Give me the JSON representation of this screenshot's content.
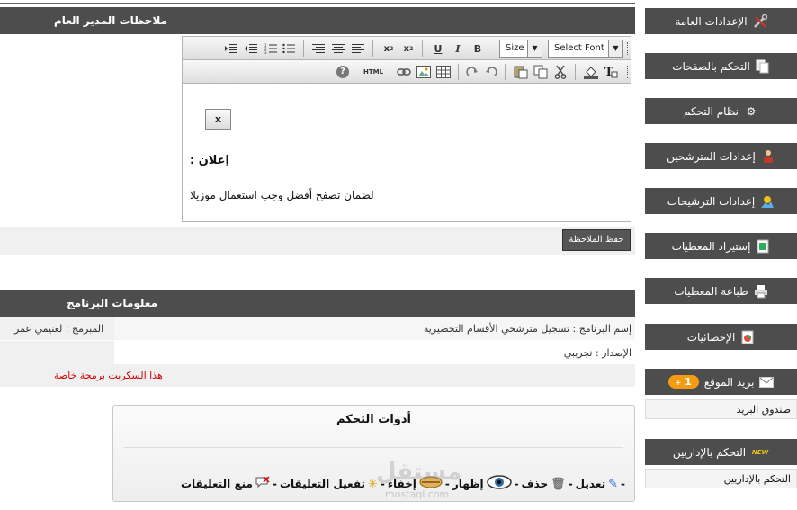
{
  "notes": {
    "header": "ملاحظات المدير العام",
    "editor": {
      "size_select": "Size",
      "font_select": "Select Font",
      "toolbar1_icons": [
        "indent-icon",
        "outdent-icon",
        "ordered-list-icon",
        "unordered-list-icon",
        "align-right-icon",
        "align-center-icon",
        "align-left-icon",
        "superscript-icon",
        "subscript-icon",
        "underline-icon",
        "italic-icon",
        "bold-icon"
      ],
      "toolbar2_icons": [
        "help-icon",
        "html-icon",
        "link-icon",
        "image-icon",
        "table-icon",
        "redo-icon",
        "undo-icon",
        "paste-icon",
        "copy-icon",
        "cut-icon",
        "background-color-icon",
        "text-color-icon"
      ],
      "toolbar_text": {
        "underline": "U",
        "italic": "I",
        "bold": "B",
        "html": "HTML",
        "help": "?"
      },
      "close_label": "x",
      "announce_title": "إعلان  :",
      "announce_body": "لضمان تصفح أفضل وجب استعمال موزيلا"
    },
    "save_button": "حفظ الملاحظة"
  },
  "program_info": {
    "header": "معلومات البرنامج",
    "name_label": "إسم البرنامج : تسجيل مترشحي الأقسام التحضيرية",
    "programmer": "المبرمج : لغنيمي عمر",
    "version_label": "الإصدار : تجريبي",
    "warning": "هذا السكربت برمجة خاصة",
    "warning_color": "#d40000"
  },
  "tools": {
    "title": "أدوات التحكم",
    "items": [
      "تعديل",
      "حذف",
      "إظهار",
      "إخفاء",
      "تفعيل التعليقات",
      "منع التعليقات"
    ],
    "separator": "-"
  },
  "watermark": {
    "text": "مستقل",
    "sub": "mostaql.com"
  },
  "sidebar": {
    "items": [
      {
        "label": "الإعدادات العامة",
        "icon": "tools-icon"
      },
      {
        "label": "التحكم بالصفحات",
        "icon": "pages-icon"
      },
      {
        "label": "نظام التحكم",
        "icon": "gear-icon"
      },
      {
        "label": "إعدادات المترشحين",
        "icon": "candidates-icon"
      },
      {
        "label": "إعدادات الترشيحات",
        "icon": "nominations-icon"
      },
      {
        "label": "إستيراد المعطيات",
        "icon": "import-icon"
      },
      {
        "label": "طباعة المعطيات",
        "icon": "printer-icon"
      },
      {
        "label": "الإحصائيات",
        "icon": "stats-icon"
      }
    ],
    "mail": {
      "label": "بريد الموقع",
      "count": "1",
      "sub": "صندوق البريد"
    },
    "admins": {
      "label": "التحكم بالإداريين",
      "badge": "NEW",
      "sub": "التحكم بالإداريين"
    }
  }
}
